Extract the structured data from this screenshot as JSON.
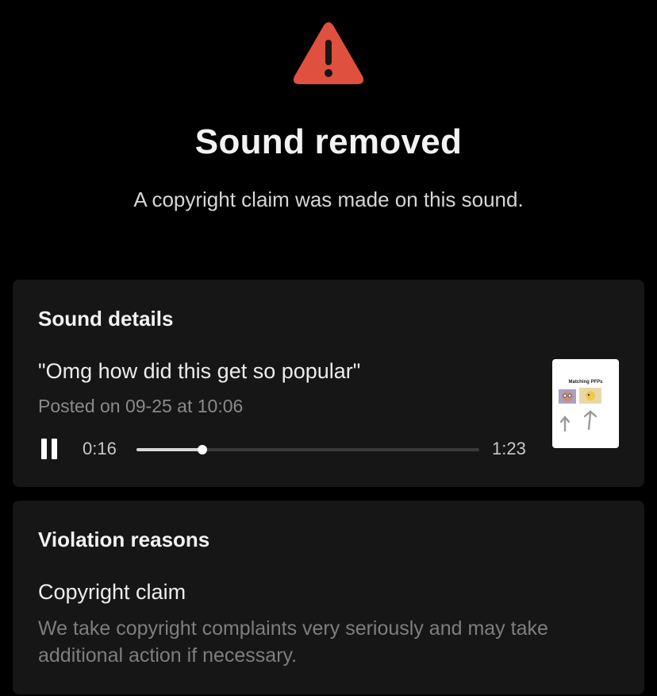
{
  "header": {
    "icon": "warning-icon",
    "title": "Sound removed",
    "subtitle": "A copyright claim was made on this sound."
  },
  "sound_details": {
    "heading": "Sound details",
    "sound_name": "\"Omg how did this get so popular\"",
    "posted": "Posted on 09-25 at 10:06",
    "player": {
      "control_icon": "pause-icon",
      "current_time": "0:16",
      "total_time": "1:23",
      "progress_fraction": 0.193
    },
    "thumbnail": {
      "caption": "Matching PFPs"
    }
  },
  "violation": {
    "heading": "Violation reasons",
    "reason_title": "Copyright claim",
    "reason_text": "We take copyright complaints very seriously and may take additional action if necessary."
  },
  "colors": {
    "background": "#000000",
    "card": "#161616",
    "warning": "#e0503f",
    "muted_text": "#8a8a8a"
  }
}
